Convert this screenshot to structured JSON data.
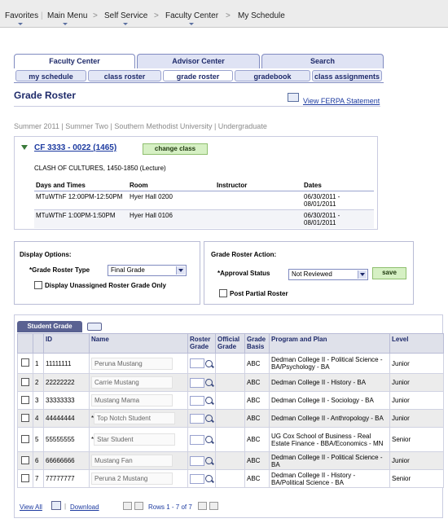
{
  "nav": {
    "favorites": "Favorites",
    "main_menu": "Main Menu",
    "self_service": "Self Service",
    "faculty_center": "Faculty Center",
    "my_schedule": "My Schedule",
    "sep": ">"
  },
  "tabs": [
    {
      "label": "Faculty Center",
      "active": true
    },
    {
      "label": "Advisor Center",
      "active": false
    },
    {
      "label": "Search",
      "active": false
    }
  ],
  "subtabs": [
    {
      "label": "my schedule"
    },
    {
      "label": "class roster"
    },
    {
      "label": "grade roster",
      "active": true
    },
    {
      "label": "gradebook"
    },
    {
      "label": "class assignments"
    }
  ],
  "page_title": "Grade Roster",
  "ferpa_link": "View FERPA Statement",
  "term_line": "Summer 2011 | Summer Two | Southern Methodist University | Undergraduate",
  "class": {
    "link": "CF 3333 - 0022 (1465)",
    "change_button": "change class",
    "title": "CLASH OF CULTURES, 1450-1850 (Lecture)",
    "headers": {
      "days": "Days and Times",
      "room": "Room",
      "instructor": "Instructor",
      "dates": "Dates"
    },
    "meetings": [
      {
        "days": "MTuWThF 12:00PM-12:50PM",
        "room": "Hyer Hall 0200",
        "instructor": "",
        "dates": "06/30/2011 - 08/01/2011"
      },
      {
        "days": "MTuWThF 1:00PM-1:50PM",
        "room": "Hyer Hall 0106",
        "instructor": "",
        "dates": "06/30/2011 - 08/01/2011"
      }
    ]
  },
  "display_options": {
    "title": "Display Options:",
    "roster_type_label": "*Grade Roster Type",
    "roster_type_value": "Final Grade",
    "unassigned_label": "Display Unassigned Roster Grade Only"
  },
  "action": {
    "title": "Grade Roster Action:",
    "approval_label": "*Approval Status",
    "approval_value": "Not Reviewed",
    "save_button": "save",
    "post_partial_label": "Post Partial Roster"
  },
  "grid": {
    "tab_label": "Student Grade",
    "headers": [
      "ID",
      "Name",
      "Roster Grade",
      "Official Grade",
      "Grade Basis",
      "Program and Plan",
      "Level"
    ],
    "rows": [
      {
        "num": "1",
        "id": "11111111",
        "flag": "",
        "name": "Peruna Mustang",
        "basis": "ABC",
        "program": "Dedman College II - Political Science - BA/Psychology - BA",
        "level": "Junior"
      },
      {
        "num": "2",
        "id": "22222222",
        "flag": "",
        "name": "Carrie Mustang",
        "basis": "ABC",
        "program": "Dedman College II - History - BA",
        "level": "Junior"
      },
      {
        "num": "3",
        "id": "33333333",
        "flag": "",
        "name": "Mustang Mama",
        "basis": "ABC",
        "program": "Dedman College II - Sociology - BA",
        "level": "Junior"
      },
      {
        "num": "4",
        "id": "44444444",
        "flag": "*",
        "name": "Top Notch Student",
        "basis": "ABC",
        "program": "Dedman College II - Anthropology - BA",
        "level": "Junior"
      },
      {
        "num": "5",
        "id": "55555555",
        "flag": "*",
        "name": "Star Student",
        "basis": "ABC",
        "program": "UG Cox School of Business - Real Estate Finance - BBA/Economics - MN",
        "level": "Senior"
      },
      {
        "num": "6",
        "id": "66666666",
        "flag": "",
        "name": "Mustang Fan",
        "basis": "ABC",
        "program": "Dedman College II - Political Science - BA",
        "level": "Junior"
      },
      {
        "num": "7",
        "id": "77777777",
        "flag": "",
        "name": "Peruna 2 Mustang",
        "basis": "ABC",
        "program": "Dedman College II - History - BA/Political Science - BA",
        "level": "Senior"
      }
    ],
    "footer": {
      "view_all": "View All",
      "download": "Download",
      "rows": "Rows 1 - 7 of 7"
    }
  }
}
